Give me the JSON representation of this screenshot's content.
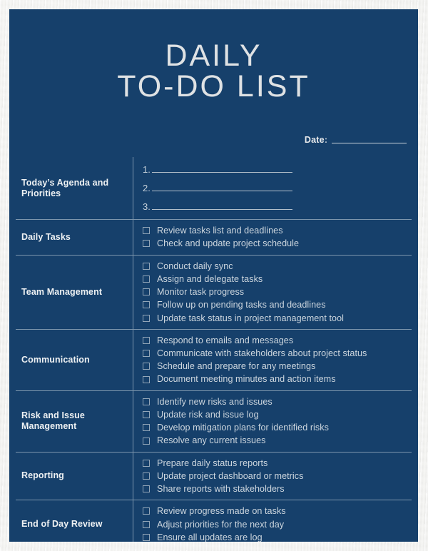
{
  "document": {
    "title_line1": "DAILY",
    "title_line2": "TO-DO LIST",
    "date_label": "Date",
    "date_colon": ":",
    "colors": {
      "sheet_background": "#16406b",
      "paper_border": "#ececeb",
      "title_text": "#dfe2e4",
      "label_text": "#eef1f3",
      "body_text": "#cdd6de",
      "rule_line": "#7d96ad",
      "checkbox_border": "#93a6b8",
      "blank_line": "#b4c0cb"
    }
  },
  "agenda_section": {
    "label": "Today’s Agenda and Priorities",
    "items": [
      {
        "number": "1."
      },
      {
        "number": "2."
      },
      {
        "number": "3."
      }
    ]
  },
  "sections": [
    {
      "label": "Daily Tasks",
      "tasks": [
        "Review tasks list and deadlines",
        "Check and update project schedule"
      ]
    },
    {
      "label": "Team Management",
      "tasks": [
        "Conduct daily sync",
        "Assign and delegate tasks",
        "Monitor task progress",
        "Follow up on pending tasks and deadlines",
        "Update task status in project management tool"
      ]
    },
    {
      "label": "Communication",
      "tasks": [
        "Respond to emails and messages",
        "Communicate with stakeholders about project status",
        "Schedule and prepare for any meetings",
        "Document meeting minutes and action items"
      ]
    },
    {
      "label": "Risk and Issue Management",
      "tasks": [
        "Identify new risks and issues",
        "Update risk and issue log",
        "Develop mitigation plans for identified risks",
        "Resolve any current issues"
      ]
    },
    {
      "label": "Reporting",
      "tasks": [
        "Prepare daily status reports",
        "Update project dashboard or metrics",
        "Share reports with stakeholders"
      ]
    },
    {
      "label": "End of Day Review",
      "tasks": [
        "Review progress made on tasks",
        "Adjust priorities for the next day",
        "Ensure all updates are log"
      ]
    }
  ]
}
